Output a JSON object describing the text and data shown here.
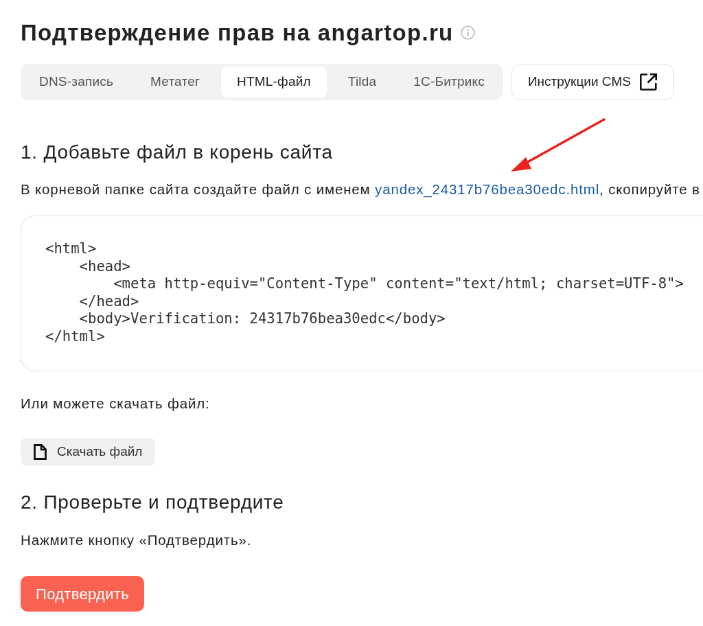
{
  "page": {
    "title": "Подтверждение прав на angartop.ru"
  },
  "tabs": [
    {
      "label": "DNS-запись",
      "selected": false
    },
    {
      "label": "Метатег",
      "selected": false
    },
    {
      "label": "HTML-файл",
      "selected": true
    },
    {
      "label": "Tilda",
      "selected": false
    },
    {
      "label": "1С-Битрикс",
      "selected": false
    }
  ],
  "cms_button": {
    "label": "Инструкции CMS"
  },
  "step_1": {
    "heading": "1. Добавьте файл в корень сайта",
    "text_before": "В корневой папке сайта создайте файл с именем ",
    "file_link": "yandex_24317b76bea30edc.html",
    "text_after": ", скопируйте в",
    "code": "<html>\n    <head>\n        <meta http-equiv=\"Content-Type\" content=\"text/html; charset=UTF-8\">\n    </head>\n    <body>Verification: 24317b76bea30edc</body>\n</html>"
  },
  "download": {
    "text": "Или можете скачать файл:",
    "button": "Скачать файл"
  },
  "step_2": {
    "heading": "2. Проверьте и подтвердите",
    "text": "Нажмите кнопку «Подтвердить».",
    "button": "Подтвердить"
  },
  "annotations": [
    {
      "kind": "arrow"
    }
  ]
}
